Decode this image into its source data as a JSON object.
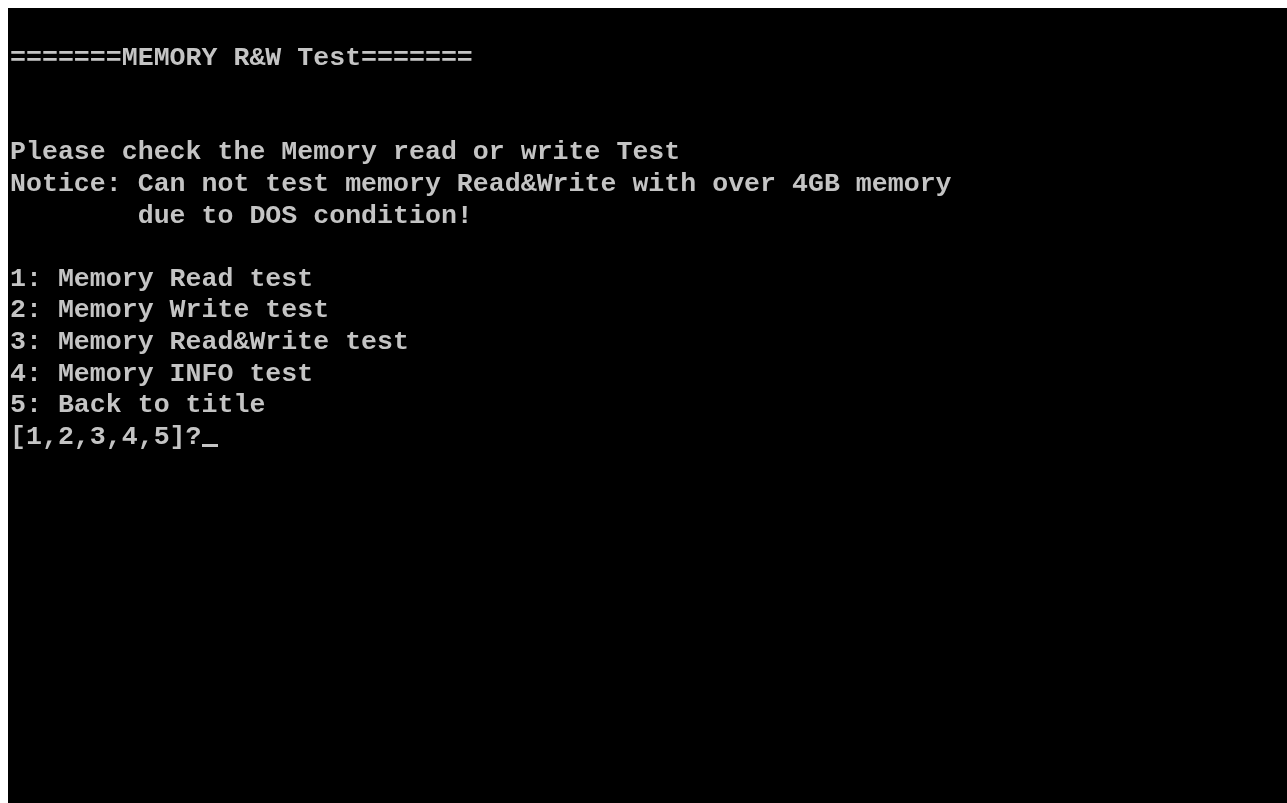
{
  "screen": {
    "title": "=======MEMORY R&W Test=======",
    "message": [
      "Please check the Memory read or write Test",
      "Notice: Can not test memory Read&Write with over 4GB memory",
      "        due to DOS condition!"
    ],
    "menu": [
      "1: Memory Read test",
      "2: Memory Write test",
      "3: Memory Read&Write test",
      "4: Memory INFO test",
      "5: Back to title"
    ],
    "prompt": "[1,2,3,4,5]?"
  }
}
